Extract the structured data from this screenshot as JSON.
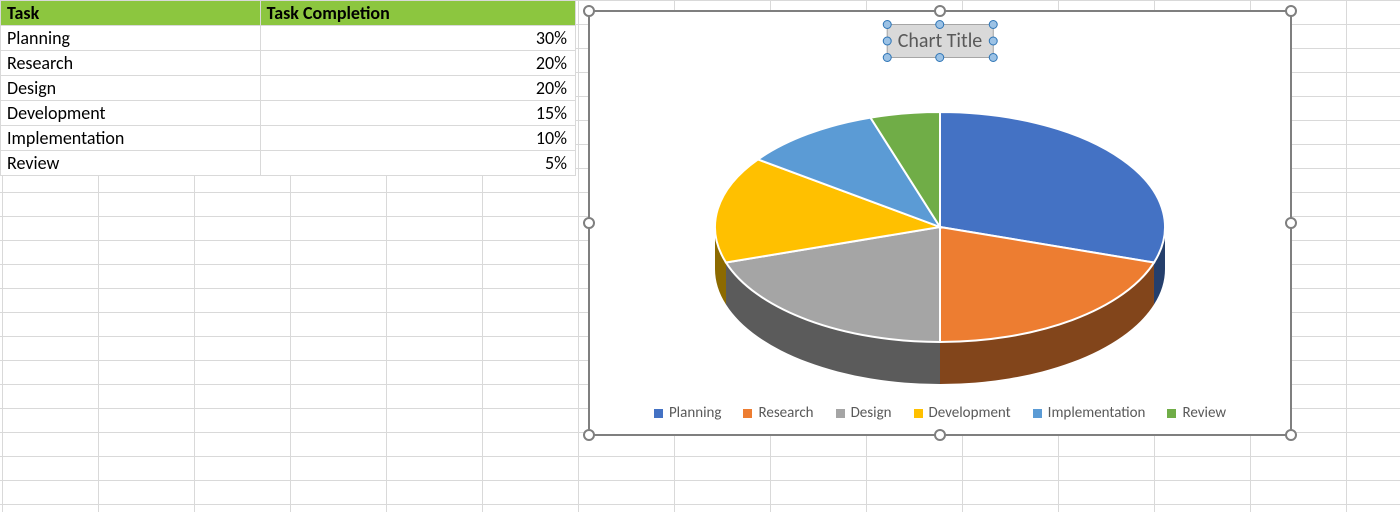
{
  "table": {
    "headers": {
      "task": "Task",
      "completion": "Task Completion"
    },
    "rows": [
      {
        "label": "Planning",
        "pct": "30%"
      },
      {
        "label": "Research",
        "pct": "20%"
      },
      {
        "label": "Design",
        "pct": "20%"
      },
      {
        "label": "Development",
        "pct": "15%"
      },
      {
        "label": "Implementation",
        "pct": "10%"
      },
      {
        "label": "Review",
        "pct": "5%"
      }
    ]
  },
  "chart": {
    "title": "Chart Title",
    "legend": [
      {
        "label": "Planning",
        "color": "#4472C4"
      },
      {
        "label": "Research",
        "color": "#ED7D31"
      },
      {
        "label": "Design",
        "color": "#A5A5A5"
      },
      {
        "label": "Development",
        "color": "#FFC000"
      },
      {
        "label": "Implementation",
        "color": "#5B9BD5"
      },
      {
        "label": "Review",
        "color": "#70AD47"
      }
    ]
  },
  "chart_data": {
    "type": "pie",
    "title": "Chart Title",
    "categories": [
      "Planning",
      "Research",
      "Design",
      "Development",
      "Implementation",
      "Review"
    ],
    "values": [
      30,
      20,
      20,
      15,
      10,
      5
    ],
    "colors": [
      "#4472C4",
      "#ED7D31",
      "#A5A5A5",
      "#FFC000",
      "#5B9BD5",
      "#70AD47"
    ]
  }
}
